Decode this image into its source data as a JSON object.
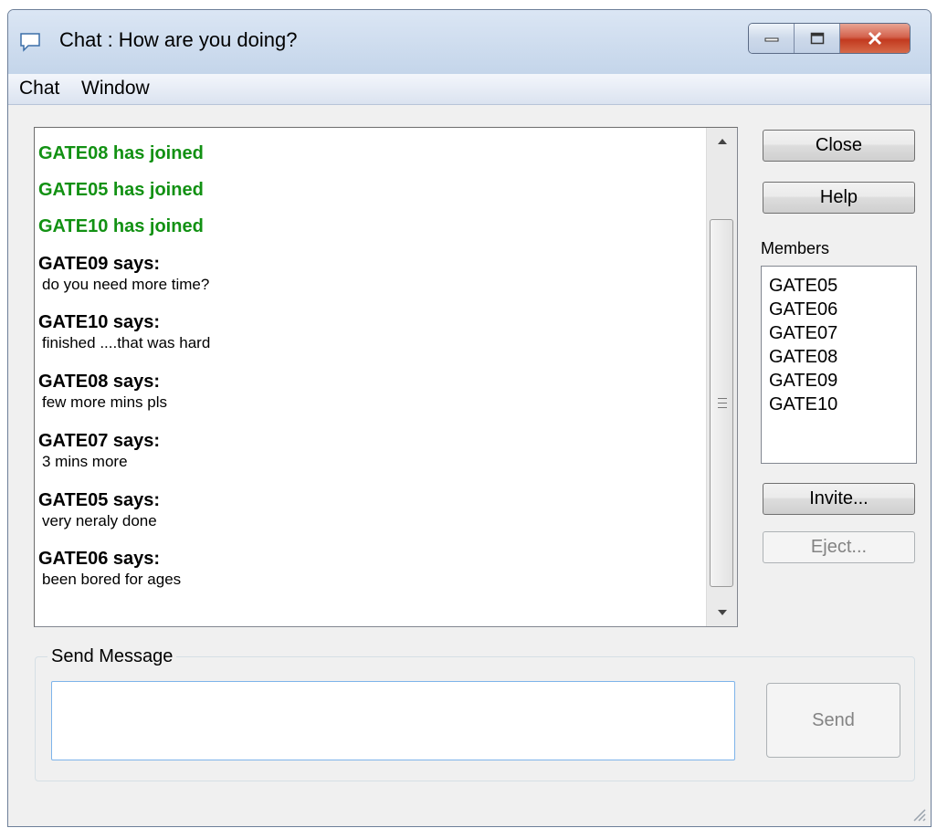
{
  "window": {
    "title": "Chat : How are you doing?"
  },
  "menu": [
    "Chat",
    "Window"
  ],
  "chat_log": {
    "joined": [
      "GATE08 has joined",
      "GATE05 has joined",
      "GATE10 has joined"
    ],
    "messages": [
      {
        "sender": "GATE09",
        "text": "do you need more time?"
      },
      {
        "sender": "GATE10",
        "text": "finished ....that was hard"
      },
      {
        "sender": "GATE08",
        "text": "few more mins pls"
      },
      {
        "sender": "GATE07",
        "text": "3 mins more"
      },
      {
        "sender": "GATE05",
        "text": "very neraly done"
      },
      {
        "sender": "GATE06",
        "text": "been bored for ages"
      }
    ],
    "says_suffix": " says:",
    "joined_color": "#129113"
  },
  "buttons": {
    "close": "Close",
    "help": "Help",
    "invite": "Invite...",
    "eject": "Eject...",
    "send": "Send"
  },
  "members": {
    "label": "Members",
    "items": [
      "GATE05",
      "GATE06",
      "GATE07",
      "GATE08",
      "GATE09",
      "GATE10"
    ]
  },
  "send_message": {
    "label": "Send Message",
    "value": ""
  },
  "icons": {
    "title": "chat-bubble-icon",
    "minimize": "minimize-icon",
    "maximize": "maximize-icon",
    "close": "close-icon",
    "scroll_up": "scroll-up-arrow-icon",
    "scroll_down": "scroll-down-arrow-icon",
    "resize": "resize-grip-icon"
  }
}
